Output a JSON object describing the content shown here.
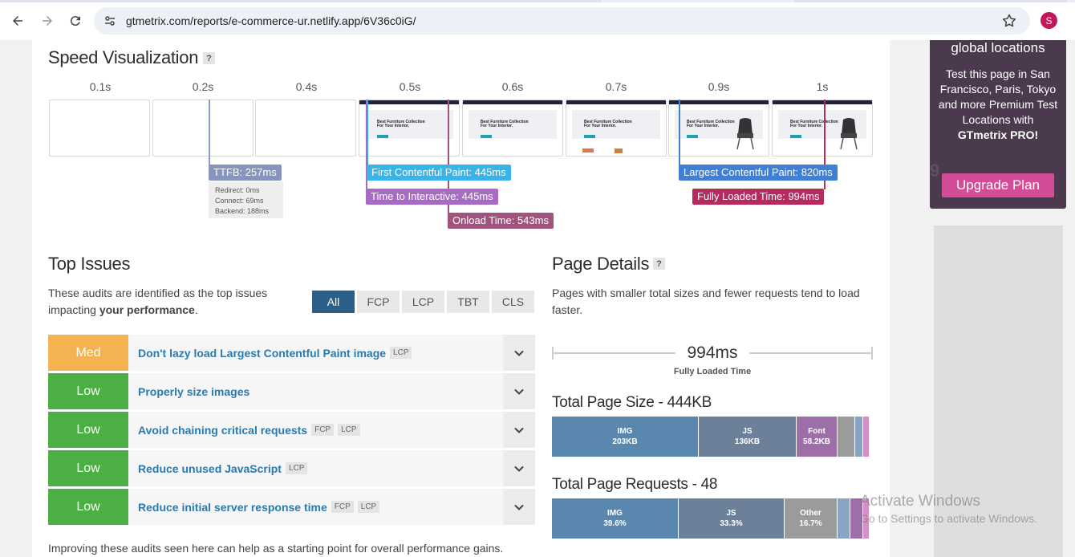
{
  "browser": {
    "url": "gtmetrix.com/reports/e-commerce-ur.netlify.app/6V36c0iG/",
    "profile_initial": "S"
  },
  "speed_visualization": {
    "title": "Speed Visualization",
    "help": "?",
    "time_labels": [
      "0.1s",
      "0.2s",
      "0.4s",
      "0.5s",
      "0.6s",
      "0.7s",
      "0.9s",
      "1s"
    ],
    "frame_hero_text": "Best Furniture Collection For Your Interior.",
    "markers": {
      "ttfb": "TTFB: 257ms",
      "redirect": "Redirect: 0ms",
      "connect": "Connect: 69ms",
      "backend": "Backend: 188ms",
      "fcp": "First Contentful Paint: 445ms",
      "tti": "Time to Interactive: 445ms",
      "onload": "Onload Time: 543ms",
      "lcp": "Largest Contentful Paint: 820ms",
      "fully_loaded": "Fully Loaded Time: 994ms"
    }
  },
  "top_issues": {
    "title": "Top Issues",
    "desc_pre": "These audits are identified as the top issues impacting ",
    "desc_bold": "your performance",
    "desc_post": ".",
    "filters": [
      "All",
      "FCP",
      "LCP",
      "TBT",
      "CLS"
    ],
    "issues": [
      {
        "severity": "Med",
        "color": "#f4b350",
        "title": "Don't lazy load Largest Contentful Paint image",
        "tags": [
          "LCP"
        ]
      },
      {
        "severity": "Low",
        "color": "#4caf43",
        "title": "Properly size images",
        "tags": []
      },
      {
        "severity": "Low",
        "color": "#4caf43",
        "title": "Avoid chaining critical requests",
        "tags": [
          "FCP",
          "LCP"
        ]
      },
      {
        "severity": "Low",
        "color": "#4caf43",
        "title": "Reduce unused JavaScript",
        "tags": [
          "LCP"
        ]
      },
      {
        "severity": "Low",
        "color": "#4caf43",
        "title": "Reduce initial server response time",
        "tags": [
          "FCP",
          "LCP"
        ]
      }
    ],
    "footer": "Improving these audits seen here can help as a starting point for overall performance gains."
  },
  "page_details": {
    "title": "Page Details",
    "help": "?",
    "desc": "Pages with smaller total sizes and fewer requests tend to load faster.",
    "fully_loaded_value": "994ms",
    "fully_loaded_label": "Fully Loaded Time",
    "size_title": "Total Page Size - 444KB",
    "size_segments": [
      {
        "name": "IMG",
        "value": "203KB",
        "color": "#5a87ad"
      },
      {
        "name": "JS",
        "value": "136KB",
        "color": "#6d809a"
      },
      {
        "name": "Font",
        "value": "58.2KB",
        "color": "#9e6ea8"
      }
    ],
    "requests_title": "Total Page Requests - 48",
    "request_segments": [
      {
        "name": "IMG",
        "value": "39.6%",
        "color": "#5a87ad"
      },
      {
        "name": "JS",
        "value": "33.3%",
        "color": "#6d809a"
      },
      {
        "name": "Other",
        "value": "16.7%",
        "color": "#9b9b9b"
      }
    ]
  },
  "promo": {
    "heading": "global locations",
    "text_pre": "Test this page in San Francisco, Paris, Tokyo and more Premium Test Locations with ",
    "text_bold": "GTmetrix PRO!",
    "button": "Upgrade Plan"
  },
  "watermark": {
    "line1": "Activate Windows",
    "line2": "Go to Settings to activate Windows."
  }
}
